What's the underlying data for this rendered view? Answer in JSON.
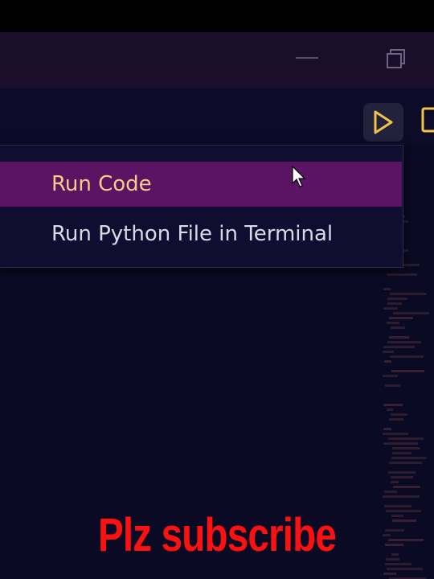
{
  "menu": {
    "items": [
      {
        "label": "Run Code",
        "highlighted": true
      },
      {
        "label": "Run Python File in Terminal",
        "highlighted": false
      }
    ]
  },
  "toolbar": {
    "run_icon": "play-icon",
    "run_icon_color": "#f2c24a"
  },
  "title_bar": {
    "icons": [
      "minimize-icon",
      "restore-icon"
    ]
  },
  "caption": {
    "text": "Plz subscribe",
    "color": "#ff1010"
  },
  "colors": {
    "highlight": "#5b1463",
    "highlight_text": "#f6cc86",
    "menu_text": "#d9dae6",
    "background": "#0c0b26"
  }
}
